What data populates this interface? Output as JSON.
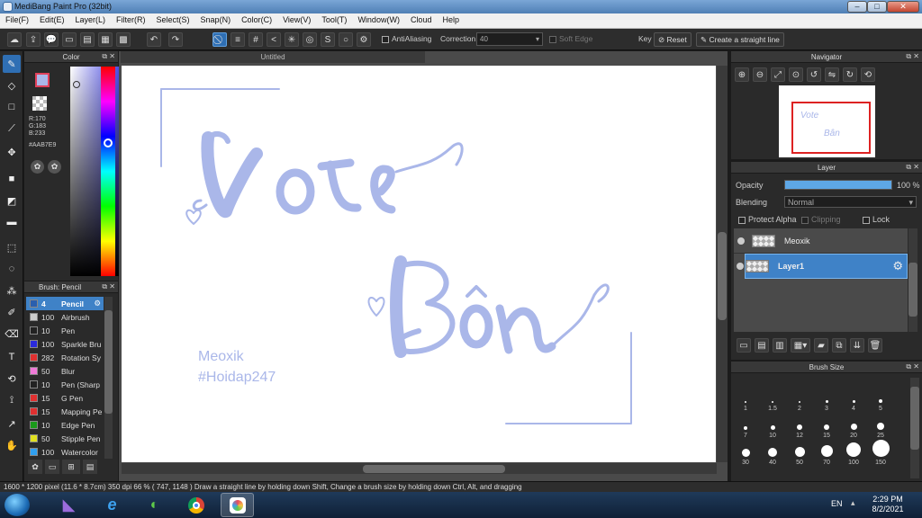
{
  "window": {
    "title": "MediBang Paint Pro (32bit)",
    "min": "–",
    "max": "□",
    "close": "✕"
  },
  "menu": [
    "File(F)",
    "Edit(E)",
    "Layer(L)",
    "Filter(R)",
    "Select(S)",
    "Snap(N)",
    "Color(C)",
    "View(V)",
    "Tool(T)",
    "Window(W)",
    "Cloud",
    "Help"
  ],
  "toolbar": {
    "antialiasing": "AntiAliasing",
    "correction_label": "Correction",
    "correction_value": "40",
    "soft_edge": "Soft Edge",
    "key": "Key",
    "reset": "Reset",
    "straight": "Create a straight line"
  },
  "color_panel": {
    "title": "Color",
    "r": "R:170",
    "g": "G:183",
    "b": "B:233",
    "hex": "#AAB7E9",
    "fg": "#AAB7E9",
    "bg_swatch": "#3ddc3d",
    "accent": "#e0405a"
  },
  "brush_panel": {
    "title": "Brush: Pencil",
    "items": [
      {
        "size": "4",
        "name": "Pencil",
        "color": "#2a5fae",
        "selected": true
      },
      {
        "size": "100",
        "name": "Airbrush",
        "color": "#cccccc"
      },
      {
        "size": "10",
        "name": "Pen",
        "color": "#222222"
      },
      {
        "size": "100",
        "name": "Sparkle Bru",
        "color": "#2a2adc"
      },
      {
        "size": "282",
        "name": "Rotation Sy",
        "color": "#e03030"
      },
      {
        "size": "50",
        "name": "Blur",
        "color": "#f07ad8"
      },
      {
        "size": "10",
        "name": "Pen (Sharp",
        "color": "#222222"
      },
      {
        "size": "15",
        "name": "G Pen",
        "color": "#e03030"
      },
      {
        "size": "15",
        "name": "Mapping Pe",
        "color": "#e03030"
      },
      {
        "size": "10",
        "name": "Edge Pen",
        "color": "#1a9a1a"
      },
      {
        "size": "50",
        "name": "Stipple Pen",
        "color": "#e0e020"
      },
      {
        "size": "100",
        "name": "Watercolor",
        "color": "#30a0f0"
      }
    ]
  },
  "document": {
    "tab": "Untitled",
    "text_line1": "Meoxik",
    "text_line2": "#Hoidap247",
    "ink": "#AAB7E9"
  },
  "navigator": {
    "title": "Navigator"
  },
  "layer_panel": {
    "title": "Layer",
    "opacity_label": "Opacity",
    "opacity_value": "100 %",
    "opacity_pct": 100,
    "blending_label": "Blending",
    "blending_value": "Normal",
    "protect_alpha": "Protect Alpha",
    "clipping": "Clipping",
    "lock": "Lock",
    "layers": [
      {
        "name": "Meoxik",
        "selected": false
      },
      {
        "name": "Layer1",
        "selected": true
      }
    ]
  },
  "brush_size": {
    "title": "Brush Size",
    "sizes": [
      "1",
      "1.5",
      "2",
      "3",
      "4",
      "5",
      "7",
      "10",
      "12",
      "15",
      "20",
      "25",
      "30",
      "40",
      "50",
      "70",
      "100",
      "150"
    ]
  },
  "status": {
    "text": "1600 * 1200 pixel   (11.6 * 8.7cm)  350 dpi   66 %   ( 747, 1148 )   Draw a straight line by holding down Shift, Change a brush size by holding down Ctrl, Alt, and dragging"
  },
  "taskbar": {
    "lang": "EN",
    "time": "2:29 PM",
    "date": "8/2/2021"
  }
}
